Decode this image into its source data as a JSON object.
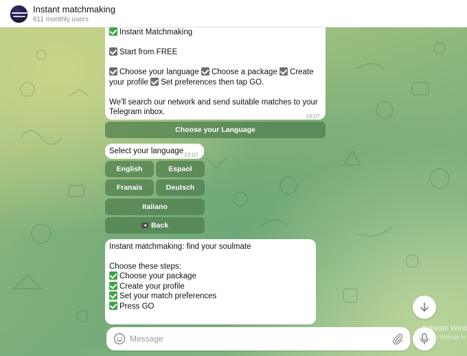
{
  "header": {
    "title": "Instant matchmaking",
    "subtitle": "611 monthly users"
  },
  "message1": {
    "line1": "Instant Matchmaking",
    "line2": "Start from FREE",
    "line3a": "Choose your language",
    "line3b": "Choose a package",
    "line3c": "Create",
    "line4a": "your profile",
    "line4b": "Set preferences then tap GO.",
    "line5": "We'll search our network and send suitable matches to your",
    "line6": "Telegram inbox.",
    "time": "19:07",
    "button": "Choose your Language"
  },
  "message2": {
    "text": "Select your language",
    "time": "19:07",
    "buttons": {
      "english": "English",
      "espanol": "Espaol",
      "francais": "Franais",
      "deutsch": "Deutsch",
      "italiano": "Italiano",
      "back": "Back"
    }
  },
  "message3": {
    "line1": "Instant matchmaking: find your soulmate",
    "line2": "Choose these steps:",
    "step1": "Choose your package",
    "step2": "Create your profile",
    "step3": "Set your match preferences",
    "step4": "Press GO"
  },
  "composer": {
    "placeholder": "Message"
  },
  "watermark": {
    "line1": "Activate Wind",
    "line2": "Go to Settings to"
  },
  "icons": {
    "avatar": "channel-avatar",
    "green_check": "green-check-emoji",
    "gray_check": "ballot-box-check-emoji",
    "back": "back-arrow-emoji",
    "smile": "emoji-icon",
    "clip": "paperclip-icon",
    "mic": "microphone-icon",
    "scroll": "arrow-down-icon"
  },
  "colors": {
    "keyboard_button": "#4e7d4e",
    "green_check": "#3ea34a",
    "bubble": "#ffffff"
  }
}
